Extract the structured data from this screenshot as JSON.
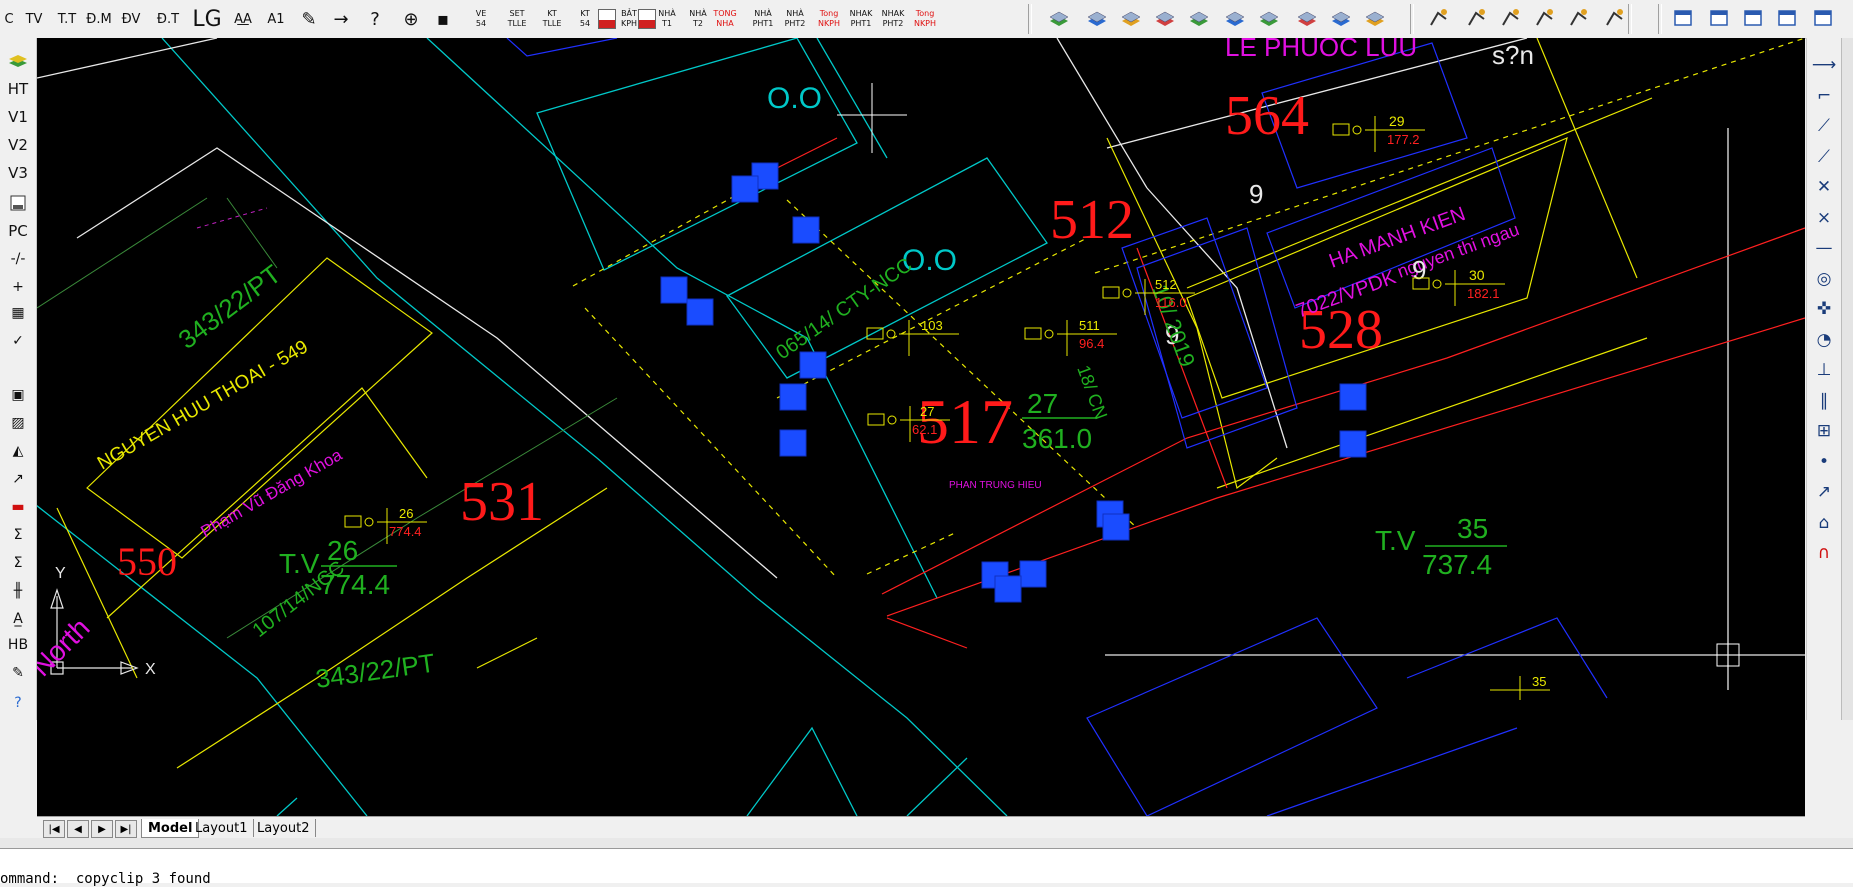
{
  "toolbar": {
    "text_tools": [
      {
        "label": "C",
        "name": "tool-c"
      },
      {
        "label": "TV",
        "name": "tool-tv"
      },
      {
        "label": "T.T",
        "name": "tool-tt"
      },
      {
        "label": "Đ.M",
        "name": "tool-dm"
      },
      {
        "label": "ĐV",
        "name": "tool-dv"
      },
      {
        "label": "Đ.T",
        "name": "tool-dt"
      },
      {
        "label": "LG",
        "name": "tool-lg"
      },
      {
        "label": "A͟A",
        "name": "tool-aa"
      },
      {
        "label": "A1",
        "name": "tool-a1"
      }
    ],
    "small_label_tools": [
      {
        "top": "VE",
        "bottom": "54",
        "name": "tool-ve-54"
      },
      {
        "top": "SET",
        "bottom": "TLLE",
        "name": "tool-set-tlle"
      },
      {
        "top": "KT",
        "bottom": "TLLE",
        "name": "tool-kt-tlle"
      },
      {
        "top": "KT",
        "bottom": "54",
        "name": "tool-kt-54"
      },
      {
        "top": "BẢT",
        "bottom": "KPH",
        "name": "tool-bat-kph"
      },
      {
        "top": "NHÀ",
        "bottom": "T1",
        "name": "tool-nha-t1"
      },
      {
        "top": "NHÀ",
        "bottom": "T2",
        "name": "tool-nha-t2"
      },
      {
        "top": "TONG",
        "bottom": "NHA",
        "name": "tool-tong-nha",
        "red": true
      },
      {
        "top": "NHÀ",
        "bottom": "PHT1",
        "name": "tool-nha-pht1"
      },
      {
        "top": "NHÀ",
        "bottom": "PHT2",
        "name": "tool-nha-pht2"
      },
      {
        "top": "Tong",
        "bottom": "NKPH",
        "name": "tool-tong-nkph",
        "red": true
      },
      {
        "top": "NHAK",
        "bottom": "PHT1",
        "name": "tool-nhak-pht1"
      },
      {
        "top": "NHAK",
        "bottom": "PHT2",
        "name": "tool-nhak-pht2"
      },
      {
        "top": "Tong",
        "bottom": "NKPH",
        "name": "tool-tong-nkph-2",
        "red": true
      }
    ]
  },
  "left_tools": [
    {
      "label": "",
      "name": "layers-icon"
    },
    {
      "label": "HT",
      "name": "tool-ht"
    },
    {
      "label": "V1",
      "name": "tool-v1"
    },
    {
      "label": "V2",
      "name": "tool-v2"
    },
    {
      "label": "V3",
      "name": "tool-v3"
    },
    {
      "label": "",
      "name": "save-icon"
    },
    {
      "label": "PC",
      "name": "tool-pc"
    }
  ],
  "tabs": {
    "model": "Model",
    "layout1": "Layout1",
    "layout2": "Layout2"
  },
  "command": {
    "text": "ommand:  copyclip 3 found"
  },
  "drawing": {
    "owners": {
      "le_phuoc_luu": "LE PHUOC LUU",
      "unknown": "s?n",
      "nguyen_huu_thoai": "NGUYEN HUU THOAI - 549",
      "pham_vu_dang_khoa": "Phạm Vũ Đăng Khoa",
      "ha_manh_kien": "HA MANH KIEN",
      "nguyen_thi_ngau": "nguyen thi ngau",
      "phan_trung_hieu": "PHAN TRUNG HIEU"
    },
    "parcel_numbers": {
      "p564": "564",
      "p512": "512",
      "p528": "528",
      "p517": "517",
      "p531": "531",
      "p550": "550"
    },
    "land_codes": {
      "oo1": "O.O",
      "oo2": "O.O",
      "nine1": "9",
      "nine2": "9",
      "nine3": "9"
    },
    "docs": {
      "d065": "065/14/ CTY-NCC",
      "d343a": "343/22/PT",
      "d343b": "343/22/PT",
      "d107": "107/14/NCC",
      "d7022": "7022/VPDK",
      "d18": "18/ CN",
      "d1019": "10/ 2019"
    },
    "areas": {
      "a27_num": "27",
      "a27_den": "361.0",
      "a35_prefix": "T.V",
      "a35_num": "35",
      "a35_den": "737.4",
      "a26_prefix": "T.V",
      "a26_num": "26",
      "a26_den": "774.4"
    },
    "points": {
      "pt29": "29",
      "pt29v": "177.2",
      "pt30": "30",
      "pt30v": "182.1",
      "pt512": "512",
      "pt512v": "116.0",
      "pt511": "511",
      "pt511v": "96.4",
      "pt103": "103",
      "pt27": "27",
      "pt27v": "62.1",
      "pt26": "26",
      "pt26v": "774.4",
      "pt35": "35"
    },
    "ucs": {
      "x": "X",
      "y": "Y"
    },
    "north": "North"
  },
  "colors": {
    "canvas": "#000000",
    "cyan": "#00c8c8",
    "red": "#ff1010",
    "green": "#20c020",
    "yellow": "#e8e800",
    "magenta": "#e010e0",
    "blue_grip": "#1a4cff"
  }
}
